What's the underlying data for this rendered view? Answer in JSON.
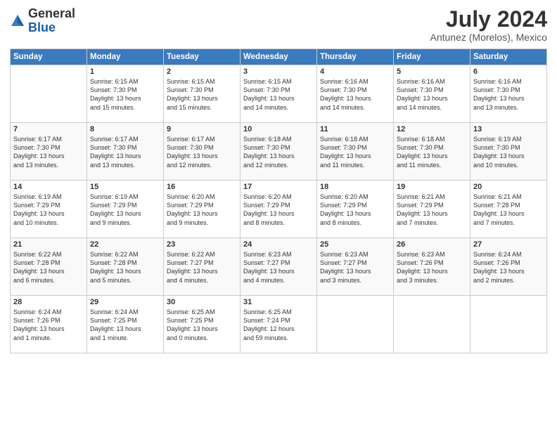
{
  "logo": {
    "general": "General",
    "blue": "Blue"
  },
  "title": {
    "main": "July 2024",
    "sub": "Antunez (Morelos), Mexico"
  },
  "calendar": {
    "headers": [
      "Sunday",
      "Monday",
      "Tuesday",
      "Wednesday",
      "Thursday",
      "Friday",
      "Saturday"
    ],
    "weeks": [
      [
        {
          "day": "",
          "info": ""
        },
        {
          "day": "1",
          "info": "Sunrise: 6:15 AM\nSunset: 7:30 PM\nDaylight: 13 hours\nand 15 minutes."
        },
        {
          "day": "2",
          "info": "Sunrise: 6:15 AM\nSunset: 7:30 PM\nDaylight: 13 hours\nand 15 minutes."
        },
        {
          "day": "3",
          "info": "Sunrise: 6:15 AM\nSunset: 7:30 PM\nDaylight: 13 hours\nand 14 minutes."
        },
        {
          "day": "4",
          "info": "Sunrise: 6:16 AM\nSunset: 7:30 PM\nDaylight: 13 hours\nand 14 minutes."
        },
        {
          "day": "5",
          "info": "Sunrise: 6:16 AM\nSunset: 7:30 PM\nDaylight: 13 hours\nand 14 minutes."
        },
        {
          "day": "6",
          "info": "Sunrise: 6:16 AM\nSunset: 7:30 PM\nDaylight: 13 hours\nand 13 minutes."
        }
      ],
      [
        {
          "day": "7",
          "info": "Sunrise: 6:17 AM\nSunset: 7:30 PM\nDaylight: 13 hours\nand 13 minutes."
        },
        {
          "day": "8",
          "info": "Sunrise: 6:17 AM\nSunset: 7:30 PM\nDaylight: 13 hours\nand 13 minutes."
        },
        {
          "day": "9",
          "info": "Sunrise: 6:17 AM\nSunset: 7:30 PM\nDaylight: 13 hours\nand 12 minutes."
        },
        {
          "day": "10",
          "info": "Sunrise: 6:18 AM\nSunset: 7:30 PM\nDaylight: 13 hours\nand 12 minutes."
        },
        {
          "day": "11",
          "info": "Sunrise: 6:18 AM\nSunset: 7:30 PM\nDaylight: 13 hours\nand 11 minutes."
        },
        {
          "day": "12",
          "info": "Sunrise: 6:18 AM\nSunset: 7:30 PM\nDaylight: 13 hours\nand 11 minutes."
        },
        {
          "day": "13",
          "info": "Sunrise: 6:19 AM\nSunset: 7:30 PM\nDaylight: 13 hours\nand 10 minutes."
        }
      ],
      [
        {
          "day": "14",
          "info": "Sunrise: 6:19 AM\nSunset: 7:29 PM\nDaylight: 13 hours\nand 10 minutes."
        },
        {
          "day": "15",
          "info": "Sunrise: 6:19 AM\nSunset: 7:29 PM\nDaylight: 13 hours\nand 9 minutes."
        },
        {
          "day": "16",
          "info": "Sunrise: 6:20 AM\nSunset: 7:29 PM\nDaylight: 13 hours\nand 9 minutes."
        },
        {
          "day": "17",
          "info": "Sunrise: 6:20 AM\nSunset: 7:29 PM\nDaylight: 13 hours\nand 8 minutes."
        },
        {
          "day": "18",
          "info": "Sunrise: 6:20 AM\nSunset: 7:29 PM\nDaylight: 13 hours\nand 8 minutes."
        },
        {
          "day": "19",
          "info": "Sunrise: 6:21 AM\nSunset: 7:29 PM\nDaylight: 13 hours\nand 7 minutes."
        },
        {
          "day": "20",
          "info": "Sunrise: 6:21 AM\nSunset: 7:28 PM\nDaylight: 13 hours\nand 7 minutes."
        }
      ],
      [
        {
          "day": "21",
          "info": "Sunrise: 6:22 AM\nSunset: 7:28 PM\nDaylight: 13 hours\nand 6 minutes."
        },
        {
          "day": "22",
          "info": "Sunrise: 6:22 AM\nSunset: 7:28 PM\nDaylight: 13 hours\nand 5 minutes."
        },
        {
          "day": "23",
          "info": "Sunrise: 6:22 AM\nSunset: 7:27 PM\nDaylight: 13 hours\nand 4 minutes."
        },
        {
          "day": "24",
          "info": "Sunrise: 6:23 AM\nSunset: 7:27 PM\nDaylight: 13 hours\nand 4 minutes."
        },
        {
          "day": "25",
          "info": "Sunrise: 6:23 AM\nSunset: 7:27 PM\nDaylight: 13 hours\nand 3 minutes."
        },
        {
          "day": "26",
          "info": "Sunrise: 6:23 AM\nSunset: 7:26 PM\nDaylight: 13 hours\nand 3 minutes."
        },
        {
          "day": "27",
          "info": "Sunrise: 6:24 AM\nSunset: 7:26 PM\nDaylight: 13 hours\nand 2 minutes."
        }
      ],
      [
        {
          "day": "28",
          "info": "Sunrise: 6:24 AM\nSunset: 7:26 PM\nDaylight: 13 hours\nand 1 minute."
        },
        {
          "day": "29",
          "info": "Sunrise: 6:24 AM\nSunset: 7:25 PM\nDaylight: 13 hours\nand 1 minute."
        },
        {
          "day": "30",
          "info": "Sunrise: 6:25 AM\nSunset: 7:25 PM\nDaylight: 13 hours\nand 0 minutes."
        },
        {
          "day": "31",
          "info": "Sunrise: 6:25 AM\nSunset: 7:24 PM\nDaylight: 12 hours\nand 59 minutes."
        },
        {
          "day": "",
          "info": ""
        },
        {
          "day": "",
          "info": ""
        },
        {
          "day": "",
          "info": ""
        }
      ]
    ]
  }
}
